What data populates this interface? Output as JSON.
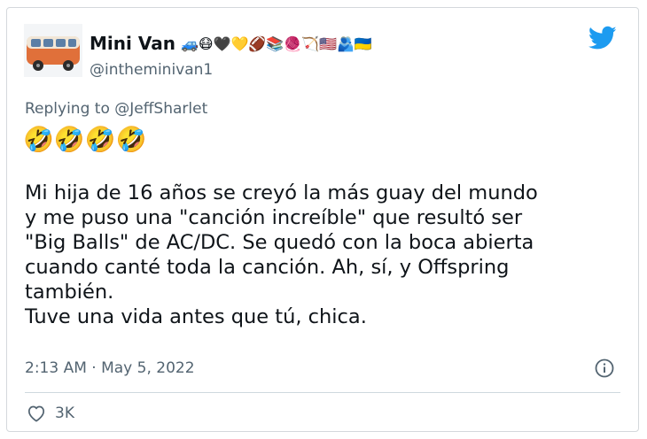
{
  "author": {
    "display_name": "Mini Van",
    "emojis": "🚙😷🖤💛🏈📚🧶🏹🇺🇸🫂🇺🇦",
    "handle": "@intheminivan1"
  },
  "reply": {
    "prefix": "Replying to ",
    "mention": "@JeffSharlet"
  },
  "reaction_emojis": "🤣🤣🤣🤣",
  "tweet_text": "Mi hija de 16 años se creyó la más guay del mundo\ny me puso una \"canción increíble\" que resultó ser\n\"Big Balls\" de AC/DC. Se quedó con la boca abierta\ncuando canté toda la canción. Ah, sí, y Offspring\ntambién.\nTuve una vida antes que tú, chica.",
  "timestamp": "2:13 AM · May 5, 2022",
  "likes": "3K",
  "icons": {
    "brand": "twitter-bird-icon",
    "info": "info-icon",
    "like": "heart-icon"
  },
  "colors": {
    "twitter_blue": "#1d9bf0",
    "van_orange": "#e0703a",
    "secondary_text": "#536471"
  }
}
